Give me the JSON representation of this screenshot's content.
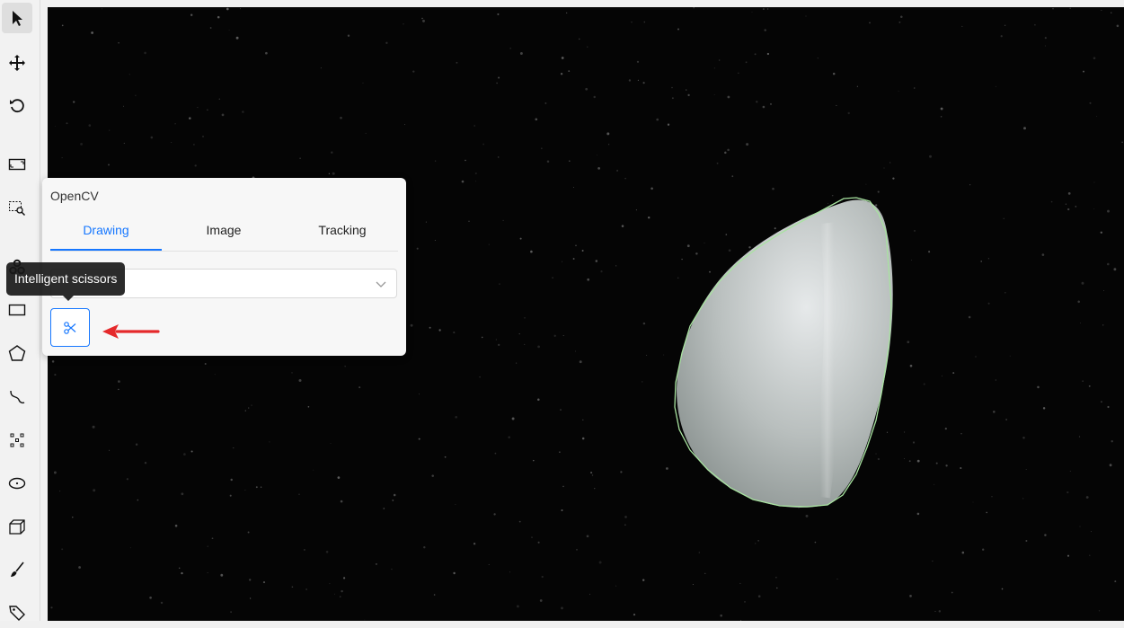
{
  "toolbar": {
    "tools": [
      {
        "name": "cursor-icon",
        "active": true
      },
      {
        "name": "move-icon"
      },
      {
        "name": "rotate-icon"
      },
      {
        "name": "fit-image-icon"
      },
      {
        "name": "zoom-region-icon"
      },
      {
        "name": "opencv-icon"
      },
      {
        "name": "rectangle-icon"
      },
      {
        "name": "polygon-icon"
      },
      {
        "name": "polyline-icon"
      },
      {
        "name": "points-icon"
      },
      {
        "name": "ellipse-icon"
      },
      {
        "name": "cuboid-icon"
      },
      {
        "name": "brush-icon"
      },
      {
        "name": "tag-icon"
      }
    ]
  },
  "panel": {
    "title": "OpenCV",
    "tabs": [
      {
        "label": "Drawing",
        "active": true
      },
      {
        "label": "Image"
      },
      {
        "label": "Tracking"
      }
    ],
    "select_value": "",
    "tool_button_icon": "scissors-icon"
  },
  "tooltip": {
    "text": "Intelligent scissors"
  },
  "colors": {
    "accent": "#1677ff",
    "annotation_outline": "#a8e3a0",
    "arrow": "#e5292b",
    "canvas_bg": "#050505"
  }
}
